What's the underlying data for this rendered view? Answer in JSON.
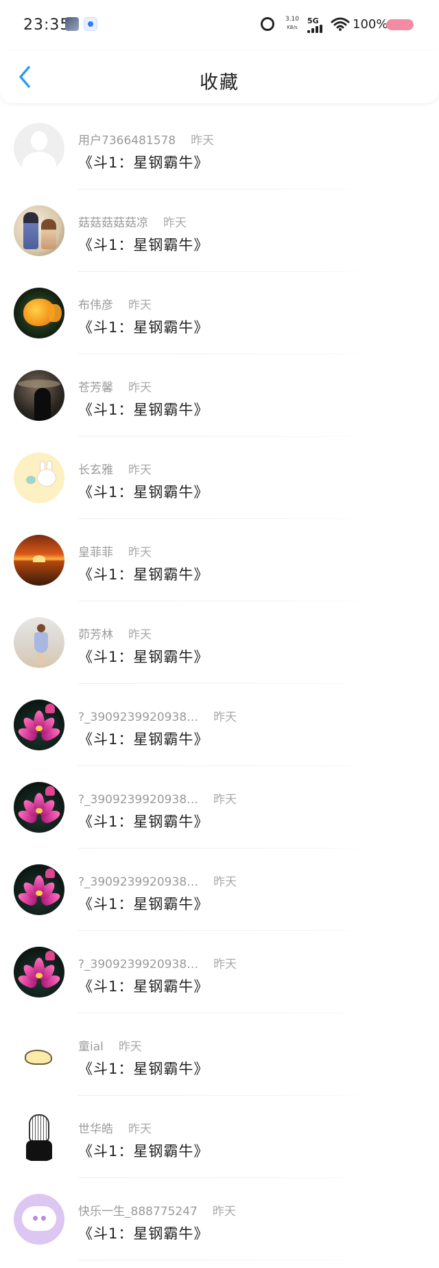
{
  "status_bar": {
    "time": "23:35",
    "net_speed": "3.10",
    "net_unit": "KB/s",
    "signal": "5G",
    "battery": "100%"
  },
  "header": {
    "title": "收藏",
    "back_icon": "chevron-left-icon"
  },
  "colors": {
    "accent_blue": "#2e9cf0",
    "battery_pink": "#f58ba0",
    "meta_gray": "#9a9a9a"
  },
  "items": [
    {
      "name": "用户7366481578",
      "time": "昨天",
      "title": "《斗1：星钢霸牛》",
      "avatar": "default"
    },
    {
      "name": "菇菇菇菇菇凉",
      "time": "昨天",
      "title": "《斗1：星钢霸牛》",
      "avatar": "anime"
    },
    {
      "name": "布伟彦",
      "time": "昨天",
      "title": "《斗1：星钢霸牛》",
      "avatar": "fish"
    },
    {
      "name": "苍芳馨",
      "time": "昨天",
      "title": "《斗1：星钢霸牛》",
      "avatar": "dark"
    },
    {
      "name": "长玄雅",
      "time": "昨天",
      "title": "《斗1：星钢霸牛》",
      "avatar": "bunny"
    },
    {
      "name": "皇菲菲",
      "time": "昨天",
      "title": "《斗1：星钢霸牛》",
      "avatar": "sunset"
    },
    {
      "name": "茆芳林",
      "time": "昨天",
      "title": "《斗1：星钢霸牛》",
      "avatar": "beach"
    },
    {
      "name": "?_3909239920938…",
      "time": "昨天",
      "title": "《斗1：星钢霸牛》",
      "avatar": "lotus"
    },
    {
      "name": "?_3909239920938…",
      "time": "昨天",
      "title": "《斗1：星钢霸牛》",
      "avatar": "lotus"
    },
    {
      "name": "?_3909239920938…",
      "time": "昨天",
      "title": "《斗1：星钢霸牛》",
      "avatar": "lotus"
    },
    {
      "name": "?_3909239920938…",
      "time": "昨天",
      "title": "《斗1：星钢霸牛》",
      "avatar": "lotus"
    },
    {
      "name": "童ial",
      "time": "昨天",
      "title": "《斗1：星钢霸牛》",
      "avatar": "sticker"
    },
    {
      "name": "世华皓",
      "time": "昨天",
      "title": "《斗1：星钢霸牛》",
      "avatar": "sketch"
    },
    {
      "name": "快乐一生_888775247",
      "time": "昨天",
      "title": "《斗1：星钢霸牛》",
      "avatar": "chat"
    }
  ]
}
